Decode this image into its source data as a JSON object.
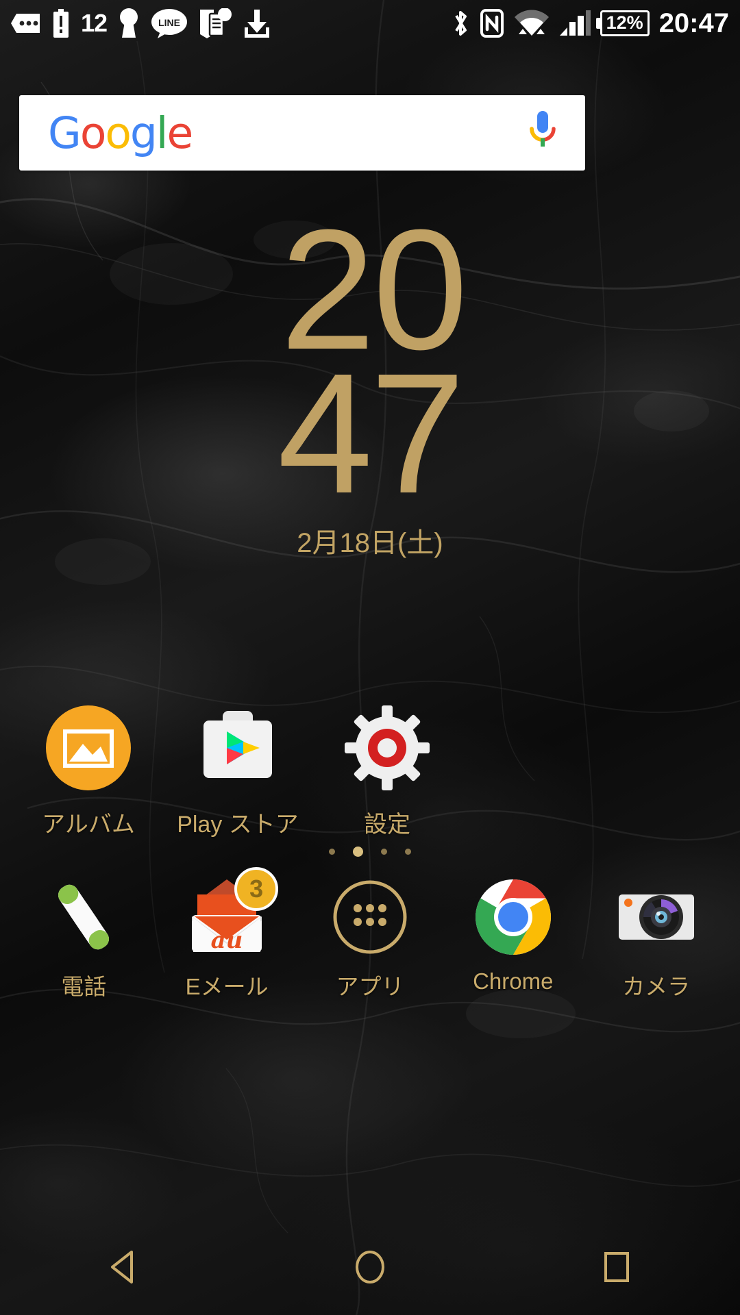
{
  "status_bar": {
    "notification_icons": [
      {
        "name": "more-notifications-icon",
        "glyph": "•••"
      },
      {
        "name": "battery-alert-icon",
        "glyph": "!"
      },
      {
        "name": "unread-count-icon",
        "label": "12"
      },
      {
        "name": "keyhole-icon",
        "glyph": "keyhole"
      },
      {
        "name": "line-app-icon",
        "label": "LINE"
      },
      {
        "name": "document-notification-icon",
        "glyph": "doc"
      },
      {
        "name": "download-icon",
        "glyph": "download"
      }
    ],
    "system_icons": [
      {
        "name": "bluetooth-icon",
        "glyph": "bluetooth"
      },
      {
        "name": "nfc-icon",
        "glyph": "N"
      },
      {
        "name": "wifi-icon",
        "glyph": "wifi"
      },
      {
        "name": "signal-icon",
        "glyph": "signal"
      }
    ],
    "battery_percent": "12%",
    "time": "20:47"
  },
  "search": {
    "logo_letters": [
      "G",
      "o",
      "o",
      "g",
      "l",
      "e"
    ],
    "mic_label": "voice-search",
    "placeholder": ""
  },
  "clock_widget": {
    "hours": "20",
    "minutes": "47",
    "date": "2月18日(土)",
    "accent_color": "#c0a164"
  },
  "app_grid": [
    {
      "label": "アルバム",
      "icon": "album-icon"
    },
    {
      "label": "Play ストア",
      "icon": "play-store-icon"
    },
    {
      "label": "設定",
      "icon": "settings-icon"
    }
  ],
  "page_indicator": {
    "count": 4,
    "active_index": 1
  },
  "dock": [
    {
      "label": "電話",
      "icon": "phone-icon",
      "badge": null
    },
    {
      "label": "Eメール",
      "icon": "au-email-icon",
      "badge": "3"
    },
    {
      "label": "アプリ",
      "icon": "app-drawer-icon",
      "badge": null
    },
    {
      "label": "Chrome",
      "icon": "chrome-icon",
      "badge": null
    },
    {
      "label": "カメラ",
      "icon": "camera-icon",
      "badge": null
    }
  ],
  "navigation": [
    {
      "name": "back-button",
      "icon": "triangle-left-icon"
    },
    {
      "name": "home-button",
      "icon": "circle-icon"
    },
    {
      "name": "recents-button",
      "icon": "square-icon"
    }
  ],
  "theme": {
    "accent": "#c9ab6b",
    "wallpaper": "black-marble"
  }
}
